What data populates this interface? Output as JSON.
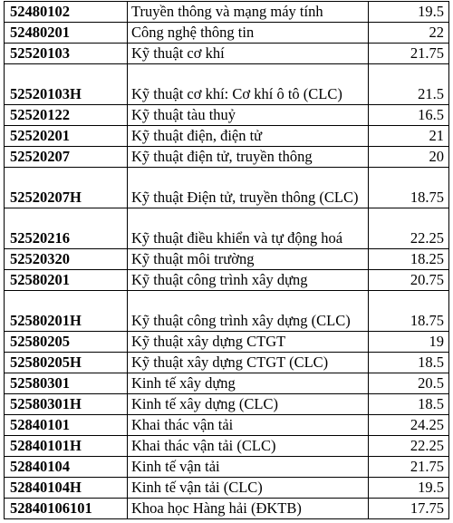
{
  "rows": [
    {
      "code": "52480102",
      "name": "Truyền thông và mạng máy tính",
      "score": "19.5"
    },
    {
      "code": "52480201",
      "name": "Công nghệ thông tin",
      "score": "22"
    },
    {
      "code": "52520103",
      "name": "Kỹ thuật cơ khí",
      "score": "21.75"
    },
    {
      "code": "52520103H",
      "name": "Kỹ thuật cơ khí: Cơ khí ô tô (CLC)",
      "score": "21.5"
    },
    {
      "code": "52520122",
      "name": "Kỹ thuật tàu thuỷ",
      "score": "16.5"
    },
    {
      "code": "52520201",
      "name": "Kỹ thuật điện, điện tử",
      "score": "21"
    },
    {
      "code": "52520207",
      "name": "Kỹ thuật điện tử, truyền thông",
      "score": "20"
    },
    {
      "code": "52520207H",
      "name": "Kỹ thuật Điện tử, truyền thông (CLC)",
      "score": "18.75"
    },
    {
      "code": "52520216",
      "name": "Kỹ thuật điều khiển và tự động hoá",
      "score": "22.25"
    },
    {
      "code": "52520320",
      "name": "Kỹ thuật môi trường",
      "score": "18.25"
    },
    {
      "code": "52580201",
      "name": "Kỹ thuật công trình xây dựng",
      "score": "20.75"
    },
    {
      "code": "52580201H",
      "name": "Kỹ thuật công trình xây dựng (CLC)",
      "score": "18.75"
    },
    {
      "code": "52580205",
      "name": "Kỹ thuật xây dựng CTGT",
      "score": "19"
    },
    {
      "code": "52580205H",
      "name": "Kỹ thuật xây dựng CTGT (CLC)",
      "score": "18.5"
    },
    {
      "code": "52580301",
      "name": "Kinh tế xây dựng",
      "score": "20.5"
    },
    {
      "code": "52580301H",
      "name": "Kinh tế xây dựng (CLC)",
      "score": "18.5"
    },
    {
      "code": "52840101",
      "name": "Khai thác vận tải",
      "score": "24.25"
    },
    {
      "code": "52840101H",
      "name": "Khai thác vận tải (CLC)",
      "score": "22.25"
    },
    {
      "code": "52840104",
      "name": "Kinh tế vận tải",
      "score": "21.75"
    },
    {
      "code": "52840104H",
      "name": "Kinh tế vận tải (CLC)",
      "score": "19.5"
    },
    {
      "code": "52840106101",
      "name": "Khoa học Hàng hải (ĐKTB)",
      "score": "17.75"
    }
  ]
}
